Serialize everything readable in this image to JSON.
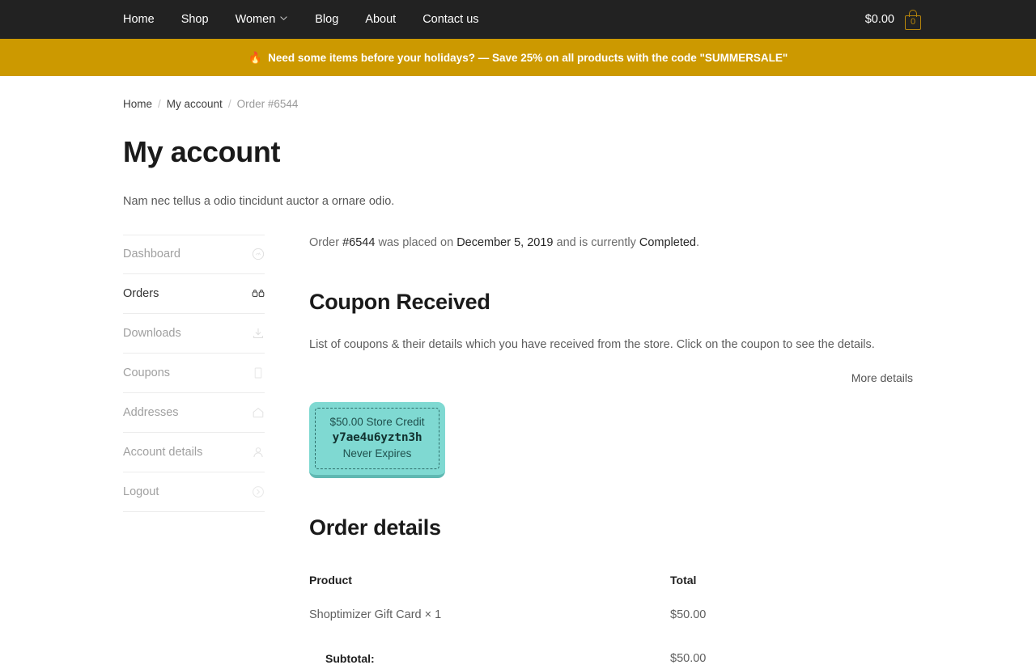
{
  "header": {
    "nav": [
      {
        "label": "Home",
        "caret": false
      },
      {
        "label": "Shop",
        "caret": false
      },
      {
        "label": "Women",
        "caret": true
      },
      {
        "label": "Blog",
        "caret": false
      },
      {
        "label": "About",
        "caret": false
      },
      {
        "label": "Contact us",
        "caret": false
      }
    ],
    "cart": {
      "amount": "$0.00",
      "count": "0",
      "icon": "shopping-bag-icon"
    },
    "background_color": "#222222"
  },
  "promo_banner": {
    "icon": "🔥",
    "text": "Need some items before your holidays? — Save 25% on all products with the code \"SUMMERSALE\"",
    "background_color": "#cc9900"
  },
  "breadcrumb": {
    "home": "Home",
    "account": "My account",
    "separator": "/",
    "current": "Order #6544"
  },
  "page": {
    "title": "My account",
    "intro": "Nam nec tellus a odio tincidunt auctor a ornare odio."
  },
  "sidebar": {
    "items": [
      {
        "label": "Dashboard",
        "icon": "dashboard-icon",
        "active": false
      },
      {
        "label": "Orders",
        "icon": "orders-icon",
        "active": true
      },
      {
        "label": "Downloads",
        "icon": "download-icon",
        "active": false
      },
      {
        "label": "Coupons",
        "icon": "coupon-icon",
        "active": false
      },
      {
        "label": "Addresses",
        "icon": "home-icon",
        "active": false
      },
      {
        "label": "Account details",
        "icon": "user-icon",
        "active": false
      },
      {
        "label": "Logout",
        "icon": "logout-icon",
        "active": false
      }
    ]
  },
  "order_status": {
    "prefix": "Order ",
    "order_number": "#6544",
    "middle": " was placed on ",
    "date": "December 5, 2019",
    "connector": " and is currently ",
    "status": "Completed",
    "suffix": "."
  },
  "coupon_section": {
    "heading": "Coupon Received",
    "description": "List of coupons & their details which you have received from the store. Click on the coupon to see the details.",
    "more_details_label": "More details",
    "coupons": [
      {
        "credit": "$50.00 Store Credit",
        "code": "y7ae4u6yztn3h",
        "expiry": "Never Expires",
        "color": "#7fd9d2"
      }
    ]
  },
  "order_details": {
    "heading": "Order details",
    "columns": {
      "product": "Product",
      "total": "Total"
    },
    "rows": [
      {
        "product": "Shoptimizer Gift Card × 1",
        "total": "$50.00"
      }
    ],
    "subtotal_label": "Subtotal:",
    "subtotal_value": "$50.00"
  }
}
